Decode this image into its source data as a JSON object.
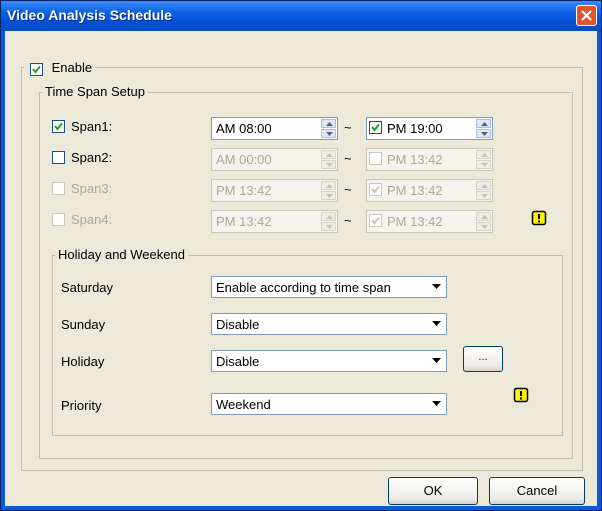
{
  "window": {
    "title": "Video Analysis Schedule"
  },
  "enable": {
    "label": "Enable",
    "checked": true
  },
  "time_span_setup": {
    "legend": "Time Span Setup",
    "spans": [
      {
        "label": "Span1:",
        "checked": true,
        "enabled": true,
        "start": "AM 08:00",
        "end": "PM 19:00",
        "end_checked": true
      },
      {
        "label": "Span2:",
        "checked": false,
        "enabled": true,
        "start": "AM 00:00",
        "end": "PM 13:42",
        "end_checked": false
      },
      {
        "label": "Span3:",
        "checked": false,
        "enabled": false,
        "start": "PM 13:42",
        "end": "PM 13:42",
        "end_checked": true
      },
      {
        "label": "Span4:",
        "checked": false,
        "enabled": false,
        "start": "PM 13:42",
        "end": "PM 13:42",
        "end_checked": true
      }
    ],
    "separator": "~"
  },
  "holiday_weekend": {
    "legend": "Holiday and Weekend",
    "saturday": {
      "label": "Saturday",
      "value": "Enable according to time span"
    },
    "sunday": {
      "label": "Sunday",
      "value": "Disable"
    },
    "holiday": {
      "label": "Holiday",
      "value": "Disable",
      "browse_label": "..."
    },
    "priority": {
      "label": "Priority",
      "value": "Weekend"
    }
  },
  "buttons": {
    "ok": "OK",
    "cancel": "Cancel"
  },
  "colors": {
    "title_bar": "#0a5fe3",
    "dialog_bg": "#ece9d8",
    "close_button": "#e0552e",
    "warning_icon": "#fff200"
  },
  "icons": [
    "close-icon",
    "checkbox-check-icon",
    "spin-up-icon",
    "spin-down-icon",
    "dropdown-arrow-icon",
    "warning-icon"
  ]
}
